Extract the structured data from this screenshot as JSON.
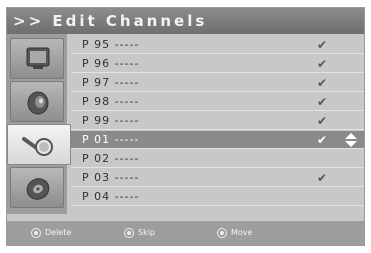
{
  "title": ">> Edit Channels",
  "sidebar": {
    "items": [
      {
        "icon": "tv-icon",
        "active": false
      },
      {
        "icon": "speaker-icon",
        "active": false
      },
      {
        "icon": "magnifier-icon",
        "active": true
      },
      {
        "icon": "setup-disc-icon",
        "active": false
      }
    ]
  },
  "channels": [
    {
      "label": "P 95 -----",
      "check": "✔"
    },
    {
      "label": "P 96 -----",
      "check": "✔"
    },
    {
      "label": "P 97 -----",
      "check": "✔"
    },
    {
      "label": "P 98 -----",
      "check": "✔"
    },
    {
      "label": "P 99 -----",
      "check": "✔"
    },
    {
      "label": "P 01 -----",
      "check": "✔"
    },
    {
      "label": "P 02 -----",
      "check": ""
    },
    {
      "label": "P 03 -----",
      "check": "✔"
    },
    {
      "label": "P 04 -----",
      "check": ""
    }
  ],
  "selected_index": 5,
  "footer": {
    "delete_label": "Delete",
    "skip_label": "Skip",
    "move_label": "Move"
  },
  "colors": {
    "panel": "#c8c8c8",
    "selected_row": "#8a8a8a",
    "sidebar": "#9d9d9d"
  }
}
